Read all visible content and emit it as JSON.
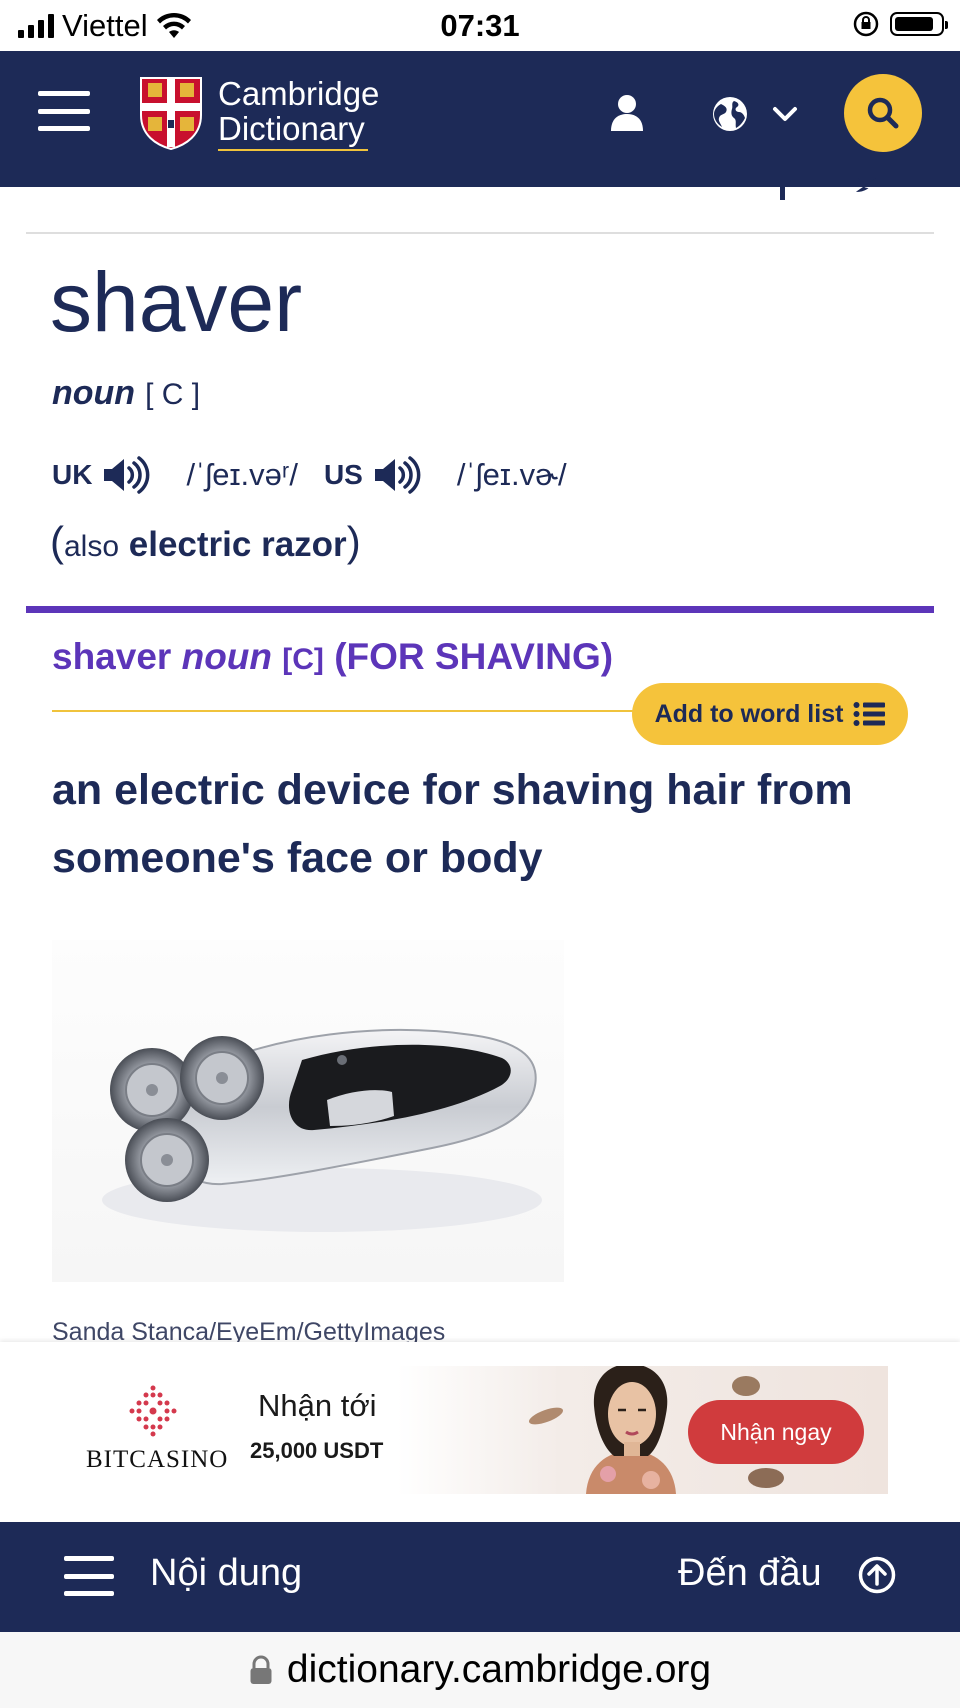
{
  "status_bar": {
    "carrier": "Viettel",
    "time": "07:31"
  },
  "header": {
    "logo_line1": "Cambridge",
    "logo_line2": "Dictionary",
    "icons": [
      "menu-icon",
      "user-icon",
      "globe-icon",
      "chevron-down-icon",
      "search-icon"
    ],
    "accent_color": "#f5c33b",
    "background_color": "#1d2a57"
  },
  "entry": {
    "headword": "shaver",
    "pos": "noun",
    "grammar": "[ C ]",
    "uk_label": "UK",
    "uk_ipa": "/ˈʃeɪ.vəʳ/",
    "us_label": "US",
    "us_ipa": "/ˈʃeɪ.vɚ/",
    "also_open": "(",
    "also_label": "also",
    "also_word": "electric razor",
    "also_close": ")"
  },
  "sense": {
    "word": "shaver",
    "pos": "noun",
    "grammar": "[C]",
    "guideword": "(FOR SHAVING)",
    "color": "#5c35b9",
    "add_to_word_list": "Add to word list",
    "definition": "an electric device for shaving hair from someone's face or body",
    "image_credit": "Sanda Stanca/EyeEm/GettyImages"
  },
  "ad": {
    "brand": "BITCASINO",
    "headline": "Nhận tới",
    "amount": "25,000 USDT",
    "cta": "Nhận ngay",
    "cta_color": "#d03b3d"
  },
  "bottom_nav": {
    "contents_label": "Nội dung",
    "top_label": "Đến đầu"
  },
  "url_bar": {
    "url": "dictionary.cambridge.org"
  }
}
